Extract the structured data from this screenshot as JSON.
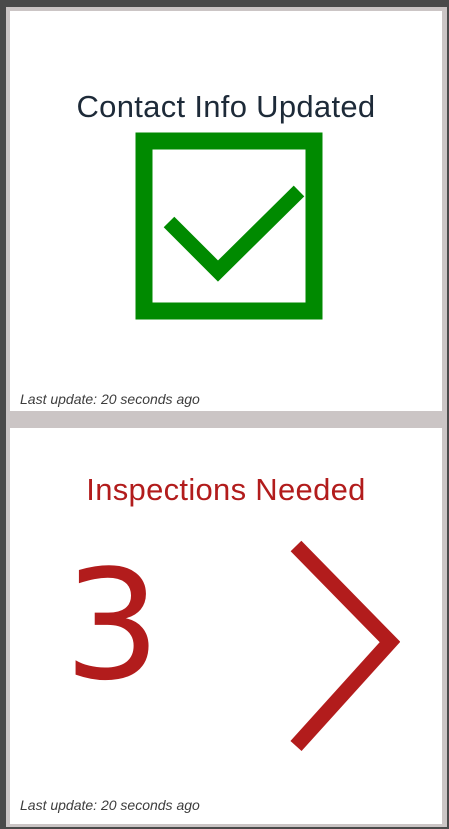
{
  "widgets": [
    {
      "title": "Contact Info Updated",
      "icon": "checkbox-checked-icon",
      "icon_color": "#008a00",
      "title_color": "#1d2a38",
      "last_update": "Last update: 20 seconds ago"
    },
    {
      "title": "Inspections Needed",
      "value": "3",
      "icon": "chevron-right-icon",
      "accent_color": "#b21c1c",
      "last_update": "Last update: 20 seconds ago"
    }
  ],
  "background_color": "#4a4a4a",
  "frame_color": "#cbc5c5"
}
